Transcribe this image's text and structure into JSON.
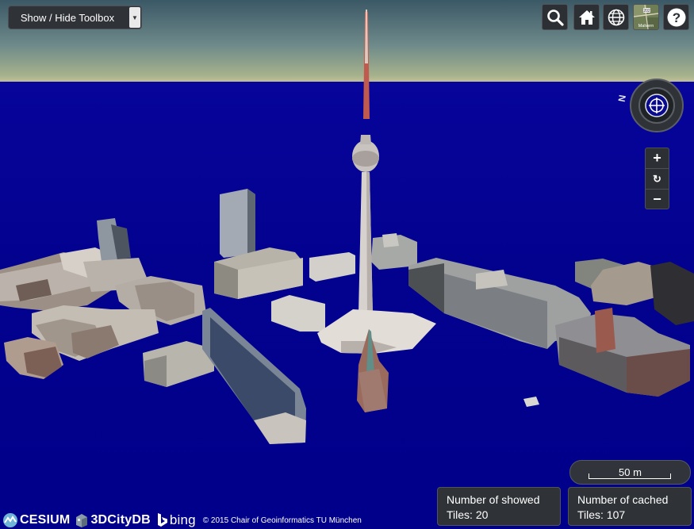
{
  "toolbox": {
    "label": "Show / Hide Toolbox"
  },
  "toolbar": {
    "search_icon": "search-icon",
    "home_icon": "home-icon",
    "scene_mode_icon": "globe-icon",
    "base_layer_icon": "map-thumbnail-icon",
    "help_icon": "question-icon",
    "base_layer_thumb_text": "Malvern"
  },
  "navigation": {
    "compass_label": "N",
    "zoom_in": "+",
    "reset": "↻",
    "zoom_out": "−"
  },
  "scale": {
    "label": "50 m"
  },
  "tiles": {
    "showed_line1": "Number of showed",
    "showed_line2": "Tiles: 20",
    "cached_line1": "Number of cached",
    "cached_line2": "Tiles: 107"
  },
  "credits": {
    "cesium": "CESIUM",
    "citydb": "3DCityDB",
    "bing": "bing",
    "copyright": "© 2015 Chair of Geoinformatics TU München"
  },
  "colors": {
    "sky_top": "#3b5866",
    "horizon": "#c6c29a",
    "ground": "#02008a",
    "panel": "#2f3337"
  }
}
